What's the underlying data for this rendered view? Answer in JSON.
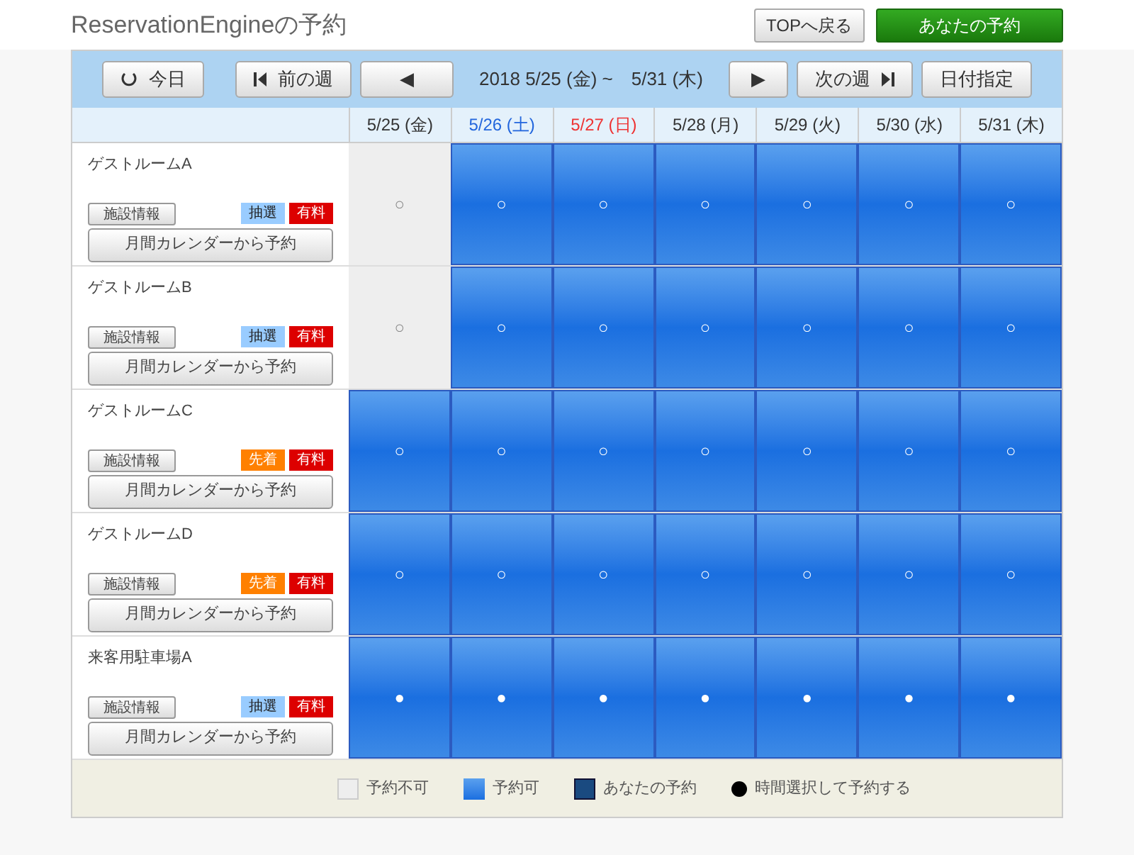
{
  "header": {
    "title": "ReservationEngineの予約",
    "buttons": [
      {
        "label": "TOPへ戻る",
        "kind": "plain"
      },
      {
        "label": "あなたの予約",
        "kind": "primary"
      }
    ]
  },
  "nav": {
    "today": "今日",
    "prev_week": "前の週",
    "prev": "◀",
    "range": "2018 5/25 (金) ~　5/31 (木)",
    "next": "▶",
    "next_week": "次の週",
    "pick_date": "日付指定"
  },
  "days": [
    {
      "label": "5/25 (金)",
      "kind": "weekday"
    },
    {
      "label": "5/26 (土)",
      "kind": "saturday"
    },
    {
      "label": "5/27 (日)",
      "kind": "sunday"
    },
    {
      "label": "5/28 (月)",
      "kind": "weekday"
    },
    {
      "label": "5/29 (火)",
      "kind": "weekday"
    },
    {
      "label": "5/30 (水)",
      "kind": "weekday"
    },
    {
      "label": "5/31 (木)",
      "kind": "weekday"
    }
  ],
  "facilities": [
    {
      "name": "ゲストルームA",
      "info_button": "施設情報",
      "tags": [
        {
          "text": "抽選",
          "kind": "lottery"
        },
        {
          "text": "有料",
          "kind": "paid"
        }
      ],
      "calendar_button": "月間カレンダーから予約",
      "cells": [
        {
          "available": false,
          "mark": "○"
        },
        {
          "available": true,
          "mark": "○"
        },
        {
          "available": true,
          "mark": "○"
        },
        {
          "available": true,
          "mark": "○"
        },
        {
          "available": true,
          "mark": "○"
        },
        {
          "available": true,
          "mark": "○"
        },
        {
          "available": true,
          "mark": "○"
        }
      ]
    },
    {
      "name": "ゲストルームB",
      "info_button": "施設情報",
      "tags": [
        {
          "text": "抽選",
          "kind": "lottery"
        },
        {
          "text": "有料",
          "kind": "paid"
        }
      ],
      "calendar_button": "月間カレンダーから予約",
      "cells": [
        {
          "available": false,
          "mark": "○"
        },
        {
          "available": true,
          "mark": "○"
        },
        {
          "available": true,
          "mark": "○"
        },
        {
          "available": true,
          "mark": "○"
        },
        {
          "available": true,
          "mark": "○"
        },
        {
          "available": true,
          "mark": "○"
        },
        {
          "available": true,
          "mark": "○"
        }
      ]
    },
    {
      "name": "ゲストルームC",
      "info_button": "施設情報",
      "tags": [
        {
          "text": "先着",
          "kind": "first"
        },
        {
          "text": "有料",
          "kind": "paid"
        }
      ],
      "calendar_button": "月間カレンダーから予約",
      "cells": [
        {
          "available": true,
          "mark": "○"
        },
        {
          "available": true,
          "mark": "○"
        },
        {
          "available": true,
          "mark": "○"
        },
        {
          "available": true,
          "mark": "○"
        },
        {
          "available": true,
          "mark": "○"
        },
        {
          "available": true,
          "mark": "○"
        },
        {
          "available": true,
          "mark": "○"
        }
      ]
    },
    {
      "name": "ゲストルームD",
      "info_button": "施設情報",
      "tags": [
        {
          "text": "先着",
          "kind": "first"
        },
        {
          "text": "有料",
          "kind": "paid"
        }
      ],
      "calendar_button": "月間カレンダーから予約",
      "cells": [
        {
          "available": true,
          "mark": "○"
        },
        {
          "available": true,
          "mark": "○"
        },
        {
          "available": true,
          "mark": "○"
        },
        {
          "available": true,
          "mark": "○"
        },
        {
          "available": true,
          "mark": "○"
        },
        {
          "available": true,
          "mark": "○"
        },
        {
          "available": true,
          "mark": "○"
        }
      ]
    },
    {
      "name": "来客用駐車場A",
      "info_button": "施設情報",
      "tags": [
        {
          "text": "抽選",
          "kind": "lottery"
        },
        {
          "text": "有料",
          "kind": "paid"
        }
      ],
      "calendar_button": "月間カレンダーから予約",
      "cells": [
        {
          "available": true,
          "mark": "●"
        },
        {
          "available": true,
          "mark": "●"
        },
        {
          "available": true,
          "mark": "●"
        },
        {
          "available": true,
          "mark": "●"
        },
        {
          "available": true,
          "mark": "●"
        },
        {
          "available": true,
          "mark": "●"
        },
        {
          "available": true,
          "mark": "●"
        }
      ]
    }
  ],
  "legend": [
    {
      "label": "予約不可",
      "kind": "unavailable"
    },
    {
      "label": "予約可",
      "kind": "available"
    },
    {
      "label": "あなたの予約",
      "kind": "mine"
    },
    {
      "label": "時間選択して予約する",
      "kind": "dot"
    }
  ]
}
